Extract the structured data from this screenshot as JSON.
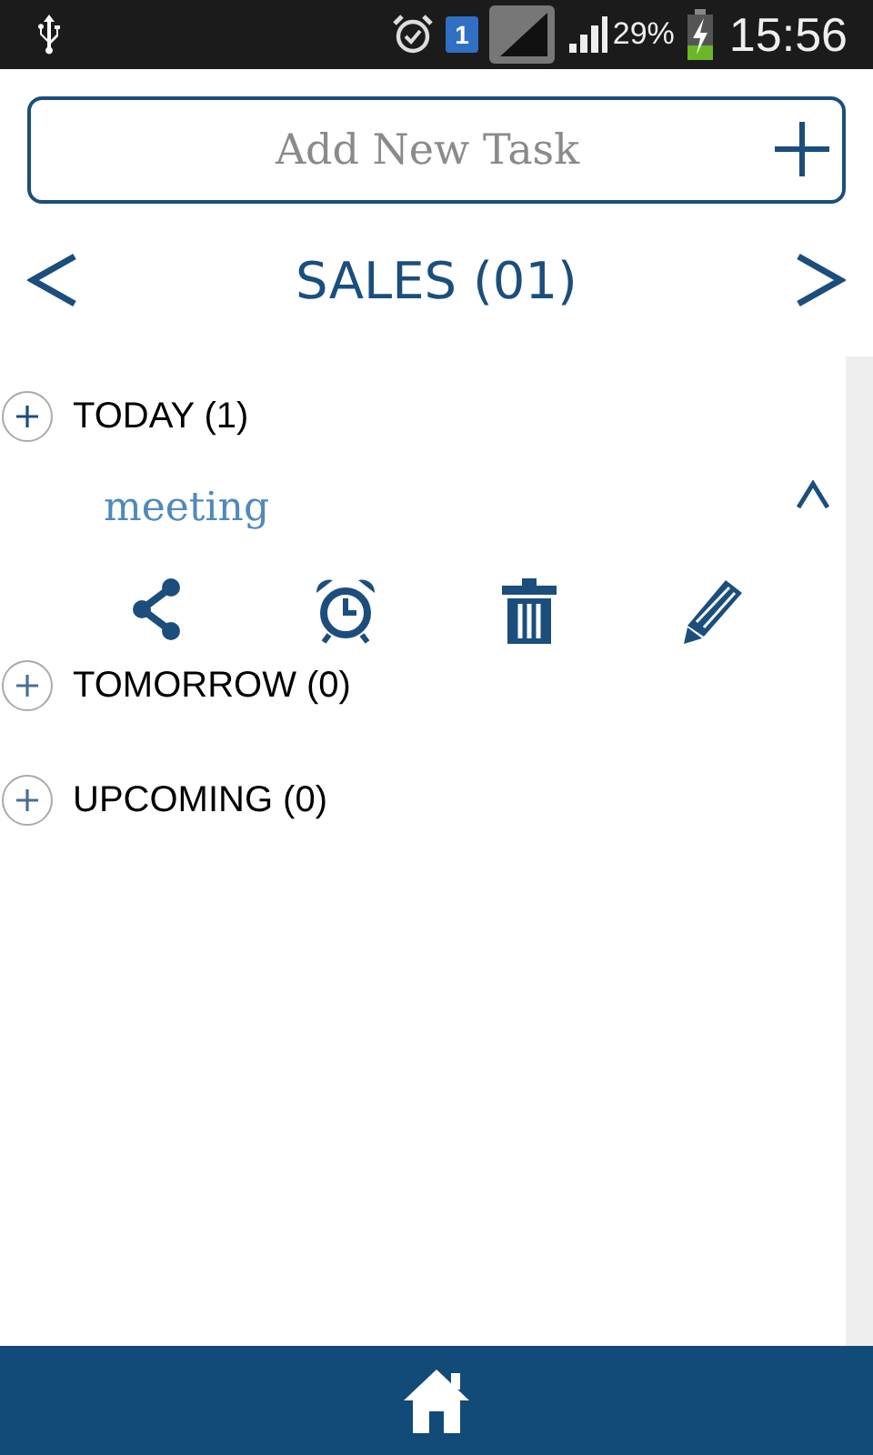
{
  "status_bar": {
    "sim": "1",
    "battery": "29%",
    "time": "15:56"
  },
  "new_task": {
    "placeholder": "Add New Task"
  },
  "category": {
    "title": "SALES (01)"
  },
  "sections": [
    {
      "label": "TODAY (1)",
      "expanded": true,
      "tasks": [
        {
          "title": "meeting",
          "expanded": true
        }
      ]
    },
    {
      "label": "TOMORROW (0)",
      "expanded": false
    },
    {
      "label": "UPCOMING (0)",
      "expanded": false
    }
  ]
}
